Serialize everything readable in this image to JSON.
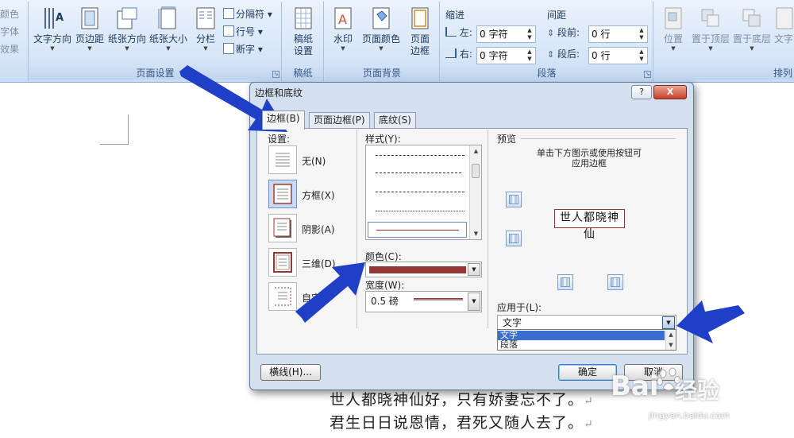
{
  "ribbon": {
    "left_partial": [
      "颜色",
      "字体",
      "效果"
    ],
    "page_setup": {
      "label": "页面设置",
      "text_direction": "文字方向",
      "margins": "页边距",
      "orientation": "纸张方向",
      "size": "纸张大小",
      "columns": "分栏",
      "breaks": "分隔符",
      "line_numbers": "行号",
      "hyphenation": "断字"
    },
    "manuscript": {
      "label": "稿纸",
      "button": "稿纸设置"
    },
    "page_background": {
      "label": "页面背景",
      "watermark": "水印",
      "page_color": "页面颜色",
      "page_borders": "页面边框"
    },
    "paragraph": {
      "label": "段落",
      "indent_heading": "缩进",
      "spacing_heading": "间距",
      "left_label": "左:",
      "left_value": "0 字符",
      "right_label": "右:",
      "right_value": "0 字符",
      "before_label": "段前:",
      "before_value": "0 行",
      "after_label": "段后:",
      "after_value": "0 行"
    },
    "arrange": {
      "label": "排列",
      "position": "位置",
      "bring_front": "置于顶层",
      "send_back": "置于底层",
      "text_wrap": "文字"
    }
  },
  "document": {
    "line1": "世人都晓神仙好，只有娇妻忘不了。",
    "line2": "君生日日说恩情，君死又随人去了。",
    "paragraph_mark": "↵"
  },
  "dialog": {
    "title": "边框和底纹",
    "help": "?",
    "close": "X",
    "tabs": [
      "边框(B)",
      "页面边框(P)",
      "底纹(S)"
    ],
    "settings_label": "设置:",
    "settings": [
      {
        "label": "无(N)"
      },
      {
        "label": "方框(X)"
      },
      {
        "label": "阴影(A)"
      },
      {
        "label": "三维(D)"
      },
      {
        "label": "自定"
      }
    ],
    "style_label": "样式(Y):",
    "color_label": "颜色(C):",
    "border_color": "#953734",
    "width_label": "宽度(W):",
    "width_value": "0.5 磅",
    "preview_label": "预览",
    "preview_hint_1": "单击下方图示或使用按钮可",
    "preview_hint_2": "应用边框",
    "preview_sample": "世人都晓神仙",
    "apply_label": "应用于(L):",
    "apply_value": "文字",
    "apply_options": [
      "文字",
      "段落"
    ],
    "horizontal_line": "横线(H)...",
    "ok": "确定",
    "cancel": "取消"
  },
  "watermark": {
    "brand": "Bai",
    "sub": "经验",
    "url": "jingyan.baidu.com"
  }
}
